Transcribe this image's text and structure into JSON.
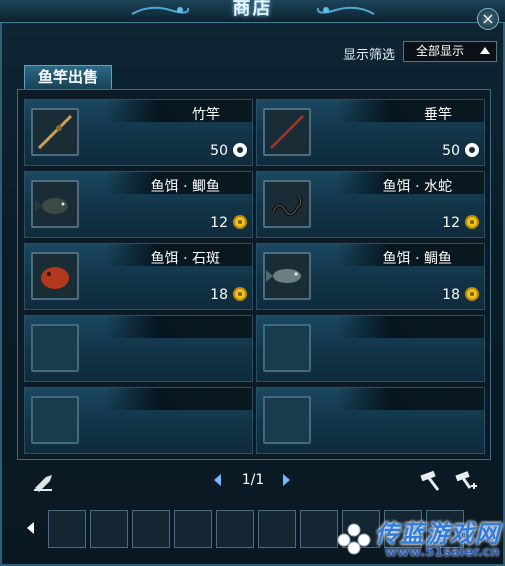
{
  "window": {
    "title": "商店",
    "close_label": "×"
  },
  "filter": {
    "label": "显示筛选",
    "selected": "全部显示"
  },
  "tabs": [
    {
      "label": "鱼竿出售"
    }
  ],
  "items": [
    {
      "name": "竹竿",
      "price": "50",
      "currency": "silver",
      "icon": "bamboo-rod-icon"
    },
    {
      "name": "垂竿",
      "price": "50",
      "currency": "silver",
      "icon": "hanging-rod-icon"
    },
    {
      "name": "鱼饵 · 鲫鱼",
      "price": "12",
      "currency": "gold",
      "icon": "crucian-fish-icon"
    },
    {
      "name": "鱼饵 · 水蛇",
      "price": "12",
      "currency": "gold",
      "icon": "water-snake-icon"
    },
    {
      "name": "鱼饵 · 石斑",
      "price": "18",
      "currency": "gold",
      "icon": "grouper-fish-icon"
    },
    {
      "name": "鱼饵 · 鲷鱼",
      "price": "18",
      "currency": "gold",
      "icon": "bream-fish-icon"
    },
    {
      "name": "",
      "price": "",
      "currency": "",
      "icon": ""
    },
    {
      "name": "",
      "price": "",
      "currency": "",
      "icon": ""
    },
    {
      "name": "",
      "price": "",
      "currency": "",
      "icon": ""
    },
    {
      "name": "",
      "price": "",
      "currency": "",
      "icon": ""
    }
  ],
  "pagination": {
    "text": "1/1"
  },
  "colors": {
    "accent": "#7ab8ff",
    "gold_coin": "#f2c21a",
    "panel": "#123347"
  },
  "watermark": {
    "text": "传蓝游戏网",
    "url": "www.51saier.cn"
  }
}
